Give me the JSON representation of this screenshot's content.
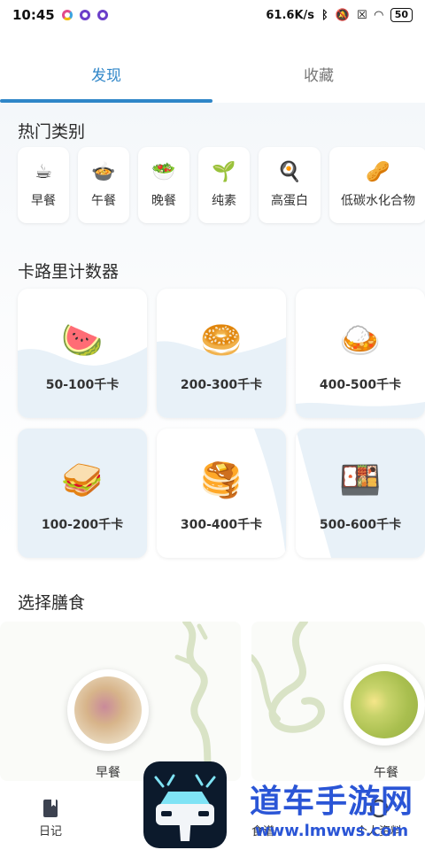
{
  "status_bar": {
    "time": "10:45",
    "network_speed": "61.6K/s",
    "battery": "50"
  },
  "tabs": [
    {
      "label": "发现",
      "active": true
    },
    {
      "label": "收藏",
      "active": false
    }
  ],
  "sections": {
    "hot_categories": "热门类别",
    "calorie_counter": "卡路里计数器",
    "choose_meal": "选择膳食"
  },
  "categories": [
    {
      "label": "早餐",
      "icon": "coffee-icon",
      "glyph": "☕"
    },
    {
      "label": "午餐",
      "icon": "pot-icon",
      "glyph": "🍲"
    },
    {
      "label": "晚餐",
      "icon": "salad-icon",
      "glyph": "🥗"
    },
    {
      "label": "纯素",
      "icon": "seedling-icon",
      "glyph": "🌱"
    },
    {
      "label": "高蛋白",
      "icon": "frying-pan-egg-icon",
      "glyph": "🍳"
    },
    {
      "label": "低碳水化合物",
      "icon": "peanut-icon",
      "glyph": "🥜"
    }
  ],
  "calorie_ranges": [
    {
      "label": "50-100千卡",
      "icon": "watermelon-icon",
      "glyph": "🍉"
    },
    {
      "label": "200-300千卡",
      "icon": "bagel-icon",
      "glyph": "🥯"
    },
    {
      "label": "400-500千卡",
      "icon": "curry-rice-icon",
      "glyph": "🍛"
    },
    {
      "label": "100-200千卡",
      "icon": "sandwich-icon",
      "glyph": "🥪"
    },
    {
      "label": "300-400千卡",
      "icon": "pancakes-icon",
      "glyph": "🥞"
    },
    {
      "label": "500-600千卡",
      "icon": "bento-box-icon",
      "glyph": "🍱"
    }
  ],
  "meals": [
    {
      "label": "早餐"
    },
    {
      "label": "午餐"
    }
  ],
  "bottom_nav": {
    "diary": "日记",
    "recipes": "食谱",
    "profile": "个人资料"
  },
  "watermark": {
    "title": "道车手游网",
    "url": "www.lmwws.com"
  },
  "colors": {
    "accent": "#2f86c8",
    "card_tint": "#e8f1f8",
    "watermark": "#2a55d6"
  }
}
